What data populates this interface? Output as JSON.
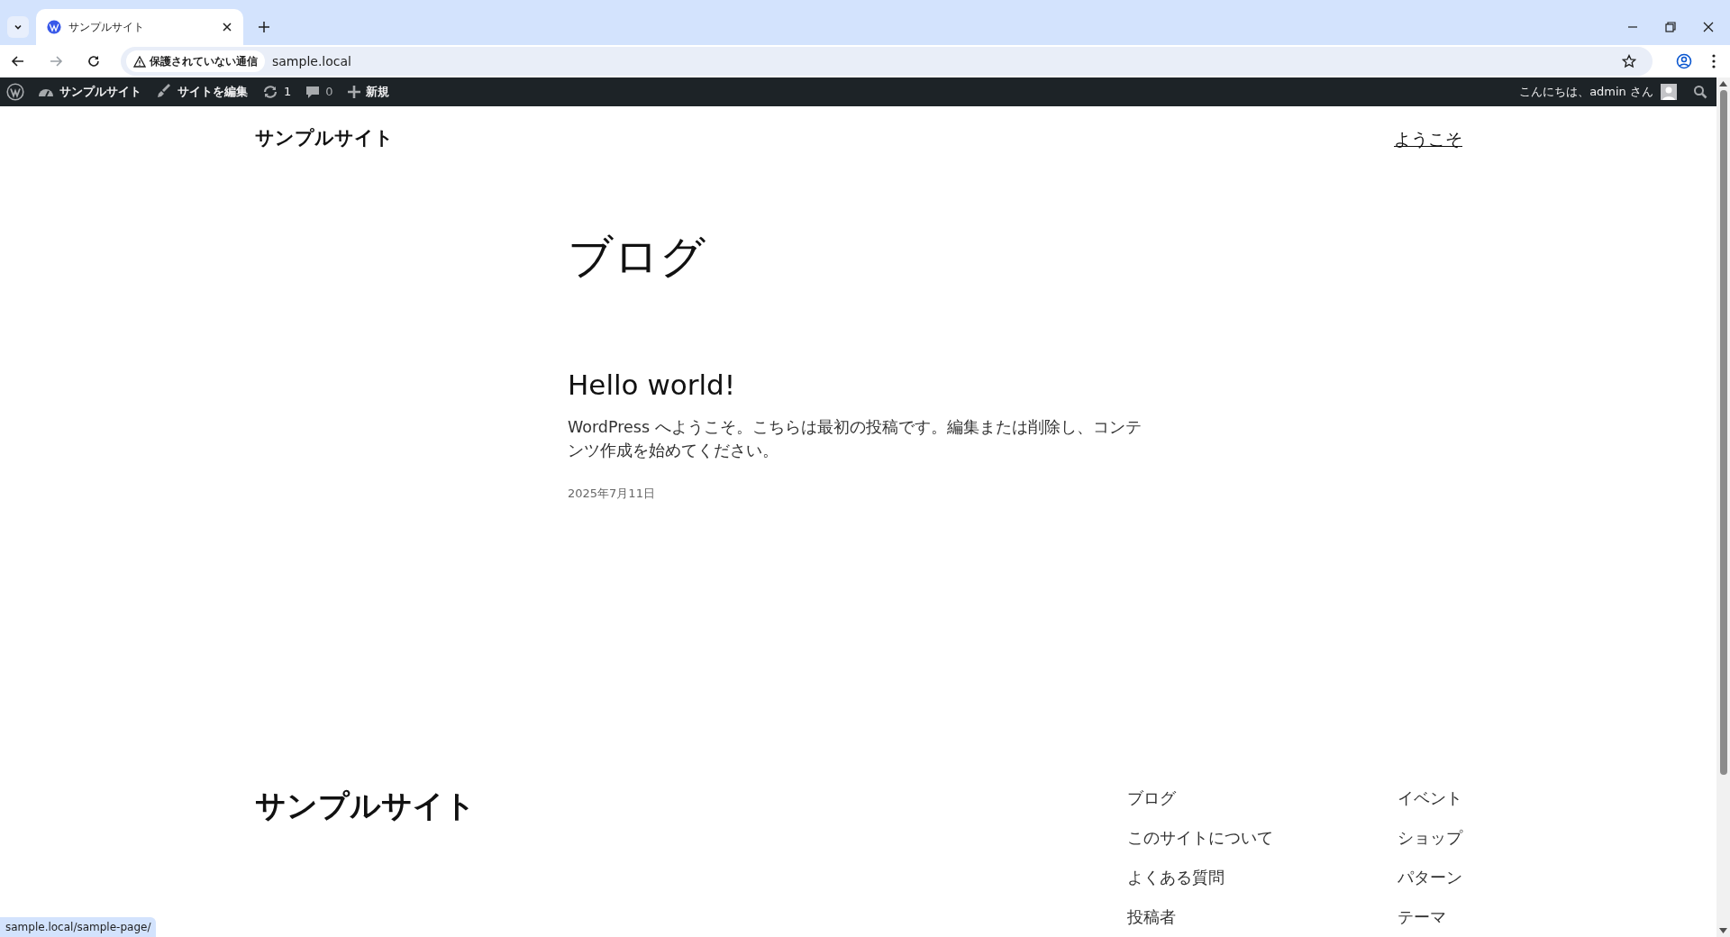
{
  "browser": {
    "tab_title": "サンプルサイト",
    "security_label": "保護されていない通信",
    "url": "sample.local"
  },
  "admin_bar": {
    "items": [
      {
        "kind": "site",
        "label": "サンプルサイト"
      },
      {
        "kind": "edit",
        "label": "サイトを編集"
      },
      {
        "kind": "updates",
        "label": "1"
      },
      {
        "kind": "comments",
        "label": "0"
      },
      {
        "kind": "new",
        "label": "新規"
      }
    ],
    "greeting": "こんにちは、admin さん"
  },
  "header": {
    "site_title": "サンプルサイト",
    "nav_link": "ようこそ"
  },
  "page_title": "ブログ",
  "posts": [
    {
      "title": "Hello world!",
      "excerpt": "WordPress へようこそ。こちらは最初の投稿です。編集または削除し、コンテンツ作成を始めてください。",
      "date": "2025年7月11日"
    }
  ],
  "footer": {
    "site_title": "サンプルサイト",
    "columns": [
      [
        "ブログ",
        "このサイトについて",
        "よくある質問",
        "投稿者"
      ],
      [
        "イベント",
        "ショップ",
        "パターン",
        "テーマ"
      ]
    ]
  },
  "status_url": "sample.local/sample-page/"
}
